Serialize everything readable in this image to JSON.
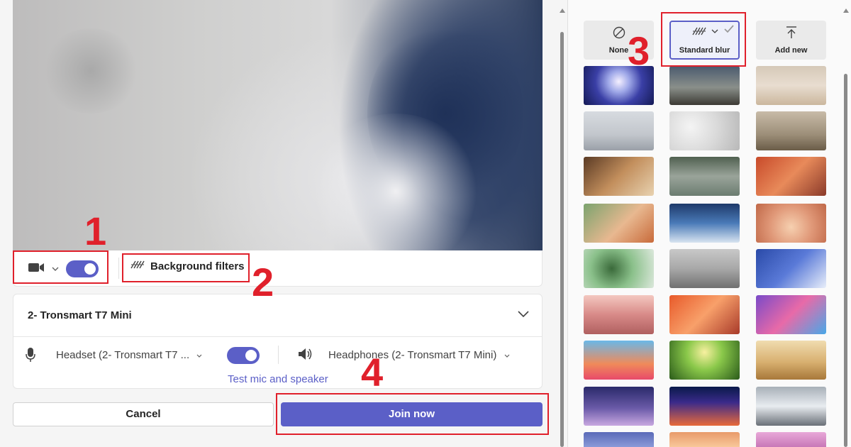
{
  "camera": {
    "background_filters_label": "Background filters"
  },
  "audio": {
    "device_name": "2- Tronsmart T7 Mini",
    "mic_label": "Headset (2- Tronsmart T7 ...",
    "speaker_label": "Headphones (2- Tronsmart T7 Mini)",
    "test_link": "Test mic and speaker"
  },
  "actions": {
    "cancel_label": "Cancel",
    "join_label": "Join now"
  },
  "background_options": [
    {
      "label": "None",
      "icon": "none-icon"
    },
    {
      "label": "Standard blur",
      "icon": "blur-icon"
    },
    {
      "label": "Add new",
      "icon": "upload-icon"
    }
  ],
  "annotations": {
    "n1": "1",
    "n2": "2",
    "n3": "3",
    "n4": "4"
  },
  "colors": {
    "accent": "#5b5fc7",
    "annotation": "#e0202b"
  }
}
